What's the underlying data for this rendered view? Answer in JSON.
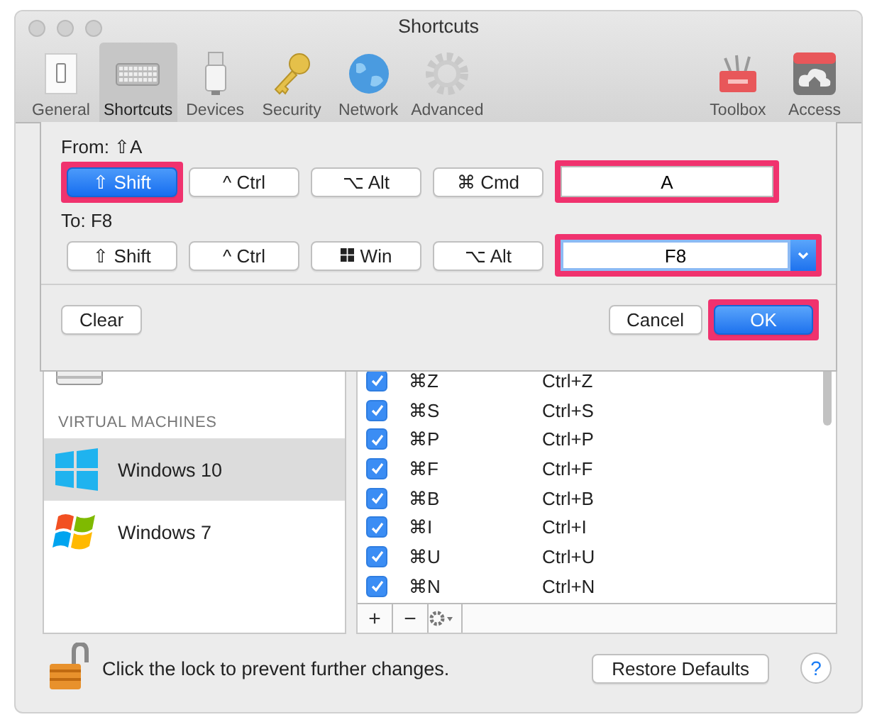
{
  "window": {
    "title": "Shortcuts"
  },
  "toolbar": {
    "items": [
      {
        "label": "General",
        "selected": false
      },
      {
        "label": "Shortcuts",
        "selected": true
      },
      {
        "label": "Devices",
        "selected": false
      },
      {
        "label": "Security",
        "selected": false
      },
      {
        "label": "Network",
        "selected": false
      },
      {
        "label": "Advanced",
        "selected": false
      }
    ],
    "right_items": [
      {
        "label": "Toolbox"
      },
      {
        "label": "Access"
      }
    ]
  },
  "sheet": {
    "from_label": "From: ⇧A",
    "from_modifiers": [
      {
        "symbol": "⇧",
        "label": "Shift",
        "selected": true,
        "highlighted": true
      },
      {
        "symbol": "^",
        "label": "Ctrl",
        "selected": false,
        "highlighted": false
      },
      {
        "symbol": "⌥",
        "label": "Alt",
        "selected": false,
        "highlighted": false
      },
      {
        "symbol": "⌘",
        "label": "Cmd",
        "selected": false,
        "highlighted": false
      }
    ],
    "from_key": {
      "value": "A",
      "highlighted": true
    },
    "to_label": "To: F8",
    "to_modifiers": [
      {
        "symbol": "⇧",
        "label": "Shift",
        "selected": false,
        "highlighted": false
      },
      {
        "symbol": "^",
        "label": "Ctrl",
        "selected": false,
        "highlighted": false
      },
      {
        "kind": "win",
        "label": "Win",
        "selected": false,
        "highlighted": false
      },
      {
        "symbol": "⌥",
        "label": "Alt",
        "selected": false,
        "highlighted": false
      }
    ],
    "to_key": {
      "value": "F8",
      "highlighted": true
    },
    "clear_button": "Clear",
    "cancel_button": "Cancel",
    "ok_button": {
      "label": "OK",
      "highlighted": true
    }
  },
  "sidebar": {
    "items": [
      {
        "kind": "item"
      },
      {
        "kind": "header",
        "label": "VIRTUAL MACHINES"
      },
      {
        "kind": "vm",
        "label": "Windows 10",
        "selected": true
      },
      {
        "kind": "vm",
        "label": "Windows 7",
        "selected": false
      }
    ]
  },
  "table": {
    "rows": [
      {
        "checked": true,
        "mac": "⌘Z",
        "win": "Ctrl+Z"
      },
      {
        "checked": true,
        "mac": "⌘S",
        "win": "Ctrl+S"
      },
      {
        "checked": true,
        "mac": "⌘P",
        "win": "Ctrl+P"
      },
      {
        "checked": true,
        "mac": "⌘F",
        "win": "Ctrl+F"
      },
      {
        "checked": true,
        "mac": "⌘B",
        "win": "Ctrl+B"
      },
      {
        "checked": true,
        "mac": "⌘I",
        "win": "Ctrl+I"
      },
      {
        "checked": true,
        "mac": "⌘U",
        "win": "Ctrl+U"
      },
      {
        "checked": true,
        "mac": "⌘N",
        "win": "Ctrl+N"
      }
    ],
    "add_button": "+",
    "remove_button": "−"
  },
  "footer": {
    "lock_text": "Click the lock to prevent further changes.",
    "restore_button": "Restore Defaults",
    "help_button": "?"
  }
}
